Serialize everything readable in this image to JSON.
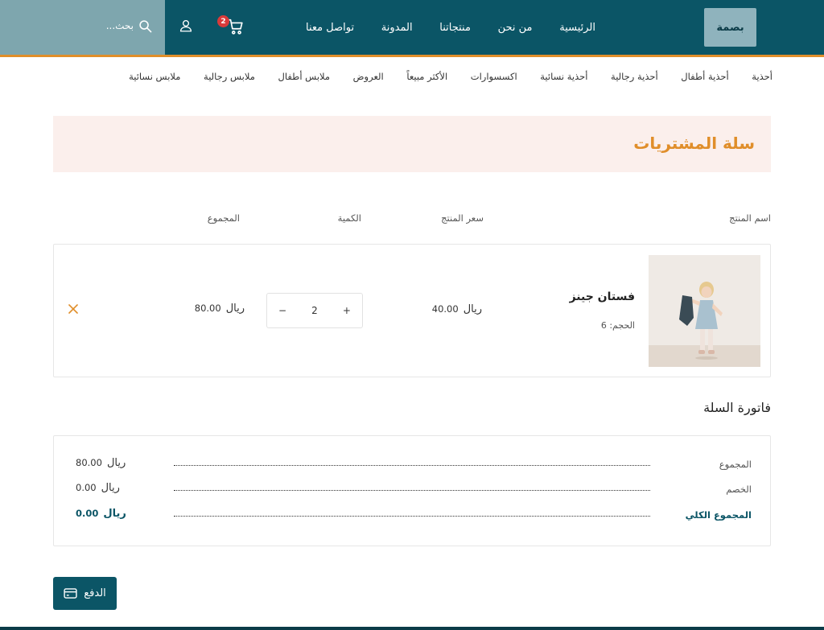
{
  "header": {
    "logo": "بصمة",
    "nav": [
      "الرئيسية",
      "من نحن",
      "منتجاتنا",
      "المدونة",
      "تواصل معنا"
    ],
    "cart_count": "2",
    "search_placeholder": "بحث..."
  },
  "categories": [
    "أحذية",
    "أحذية أطفال",
    "أحذية رجالية",
    "أحذية نسائية",
    "اكسسوارات",
    "الأكثر مبيعاً",
    "العروض",
    "ملابس أطفال",
    "ملابس رجالية",
    "ملابس نسائية"
  ],
  "page": {
    "title": "سلة المشتريات"
  },
  "table": {
    "headers": {
      "product": "اسم المنتج",
      "price": "سعر المنتج",
      "quantity": "الكمية",
      "total": "المجموع"
    }
  },
  "item": {
    "name": "فستان جينز",
    "size": "الحجم: 6",
    "price": "40.00",
    "currency": "ريال",
    "quantity": "2",
    "qty_minus": "−",
    "qty_plus": "+",
    "total": "80.00",
    "remove_icon": "close-icon"
  },
  "invoice": {
    "title": "فاتورة السلة",
    "rows": [
      {
        "label": "المجموع",
        "value": "80.00",
        "currency": "ريال"
      },
      {
        "label": "الخصم",
        "value": "0.00",
        "currency": "ريال"
      },
      {
        "label": "المجموع الكلي",
        "value": "0.00",
        "currency": "ريال"
      }
    ]
  },
  "pay_button": {
    "label": "الدفع",
    "icon": "credit-card-icon"
  },
  "colors": {
    "primary": "#0b5566",
    "accent": "#e08e2a",
    "badge": "#d93a3a",
    "title_bg": "#fbefec"
  }
}
